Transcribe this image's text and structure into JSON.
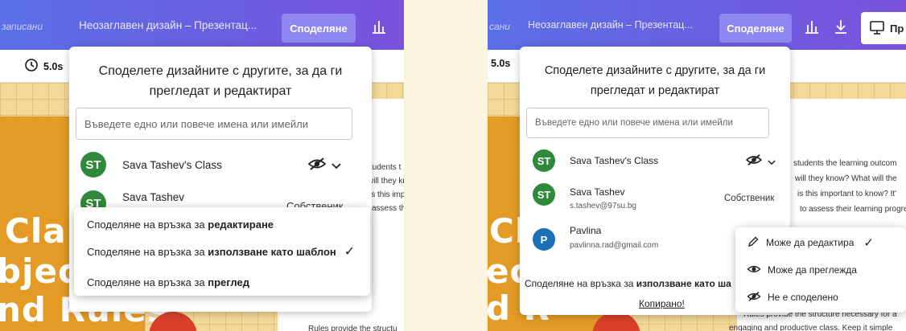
{
  "left": {
    "topbar": {
      "crumb": "записани",
      "doc_title": "Неозаглавен дизайн – Презентац...",
      "share_label": "Споделяне"
    },
    "timer": "5.0s",
    "dialog": {
      "heading_line1": "Споделете дизайните с другите, за да ги",
      "heading_line2": "прегледат и редактират",
      "input_placeholder": "Въведете едно или повече имена или имейли",
      "members": [
        {
          "initials": "ST",
          "name": "Sava Tashev's Class",
          "avatar_color": "#2e8a3a"
        },
        {
          "initials": "ST",
          "name": "Sava Tashev",
          "role": "Собственик",
          "avatar_color": "#2e8a3a"
        }
      ]
    },
    "menu": {
      "items": [
        {
          "prefix": "Споделяне на връзка за ",
          "bold": "редактиране",
          "checked": false
        },
        {
          "prefix": "Споделяне на връзка за ",
          "bold": "използване като шаблон",
          "checked": true
        },
        {
          "prefix": "Споделяне на връзка за ",
          "bold": "преглед",
          "checked": false
        }
      ],
      "check_glyph": "✓"
    },
    "slide": {
      "big_words": [
        "Cla",
        "bjec",
        "nd Rules"
      ],
      "text_lines": [
        "students t",
        "will they kr",
        "is this imp",
        "assess th"
      ],
      "footer_text": "Rules provide the structu"
    }
  },
  "right": {
    "topbar": {
      "crumb": "сани",
      "doc_title": "Неозаглавен дизайн – Презентац...",
      "share_label": "Споделяне",
      "present_label": "Пр"
    },
    "timer": "5.0s",
    "dialog": {
      "heading_line1": "Споделете дизайните с другите, за да ги",
      "heading_line2": "прегледат и редактират",
      "input_placeholder": "Въведете едно или повече имена или имейли",
      "members": [
        {
          "initials": "ST",
          "name": "Sava Tashev's Class",
          "avatar_color": "#2e8a3a"
        },
        {
          "initials": "ST",
          "name": "Sava Tashev",
          "email": "s.tashev@97su.bg",
          "role": "Собственик",
          "avatar_color": "#2e8a3a"
        },
        {
          "initials": "P",
          "name": "Pavlina",
          "email": "pavlinna.rad@gmail.com",
          "avatar_color": "#1a6fb5"
        }
      ],
      "share_prefix": "Споделяне на връзка за ",
      "share_bold": "използване като ша",
      "copied": "Копирано!"
    },
    "menu": {
      "items": [
        {
          "label": "Може да редактира",
          "icon": "pencil-icon",
          "checked": true
        },
        {
          "label": "Може да преглежда",
          "icon": "eye-icon",
          "checked": false
        },
        {
          "label": "Не е споделено",
          "icon": "eye-off-icon",
          "checked": false
        }
      ],
      "check_glyph": "✓"
    },
    "slide": {
      "big_words": [
        "Cla",
        "ec",
        "d R"
      ],
      "text_lines": [
        "students the learning outcom",
        "will they know? What will the",
        "is this important to know? It'",
        "to assess their learning progre"
      ],
      "footer_text_line1": "Rules provide the structure necessary for a",
      "footer_text_line2": "engaging and productive class. Keep it simple"
    }
  }
}
